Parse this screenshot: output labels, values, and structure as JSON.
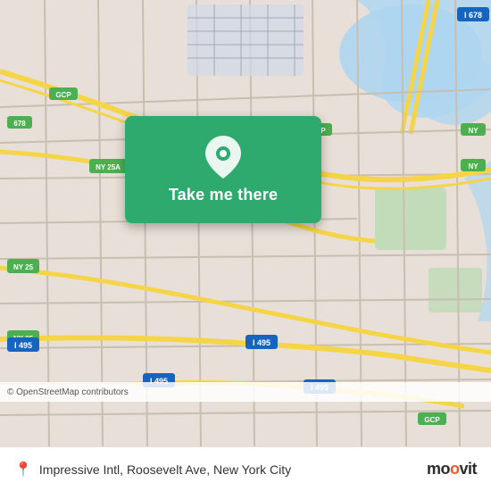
{
  "map": {
    "attribution": "© OpenStreetMap contributors",
    "bg_color": "#e8e0d8"
  },
  "cta": {
    "label": "Take me there"
  },
  "footer": {
    "location_text": "Impressive Intl, Roosevelt Ave, New York City",
    "logo": "moovit"
  },
  "icons": {
    "pin": "📍",
    "location": "📍"
  }
}
